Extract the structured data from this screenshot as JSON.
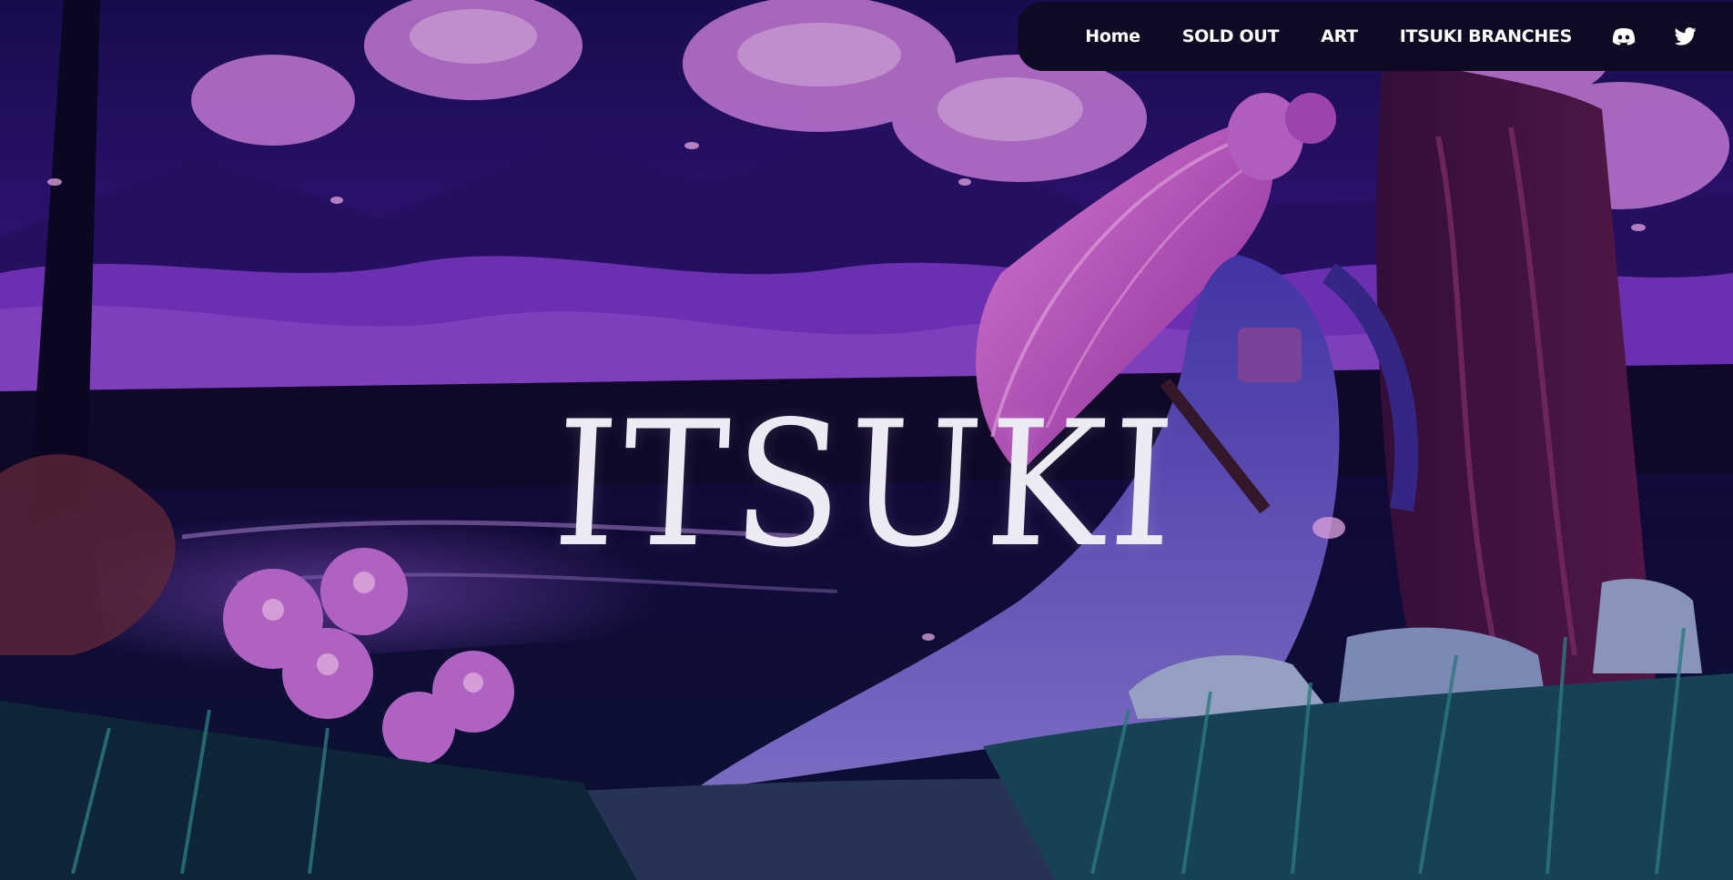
{
  "site": {
    "title": "ITSUKI"
  },
  "nav": {
    "items": [
      {
        "label": "Home"
      },
      {
        "label": "SOLD OUT"
      },
      {
        "label": "ART"
      },
      {
        "label": "ITSUKI BRANCHES"
      }
    ],
    "icons": [
      "discord-icon",
      "twitter-icon"
    ]
  },
  "colors": {
    "nav_background": "#0d0b24",
    "nav_text": "#ffffff",
    "title_text": "#eeeaf4",
    "scene_purple": "#5b22a8",
    "blossom_pink": "#d887e6"
  }
}
